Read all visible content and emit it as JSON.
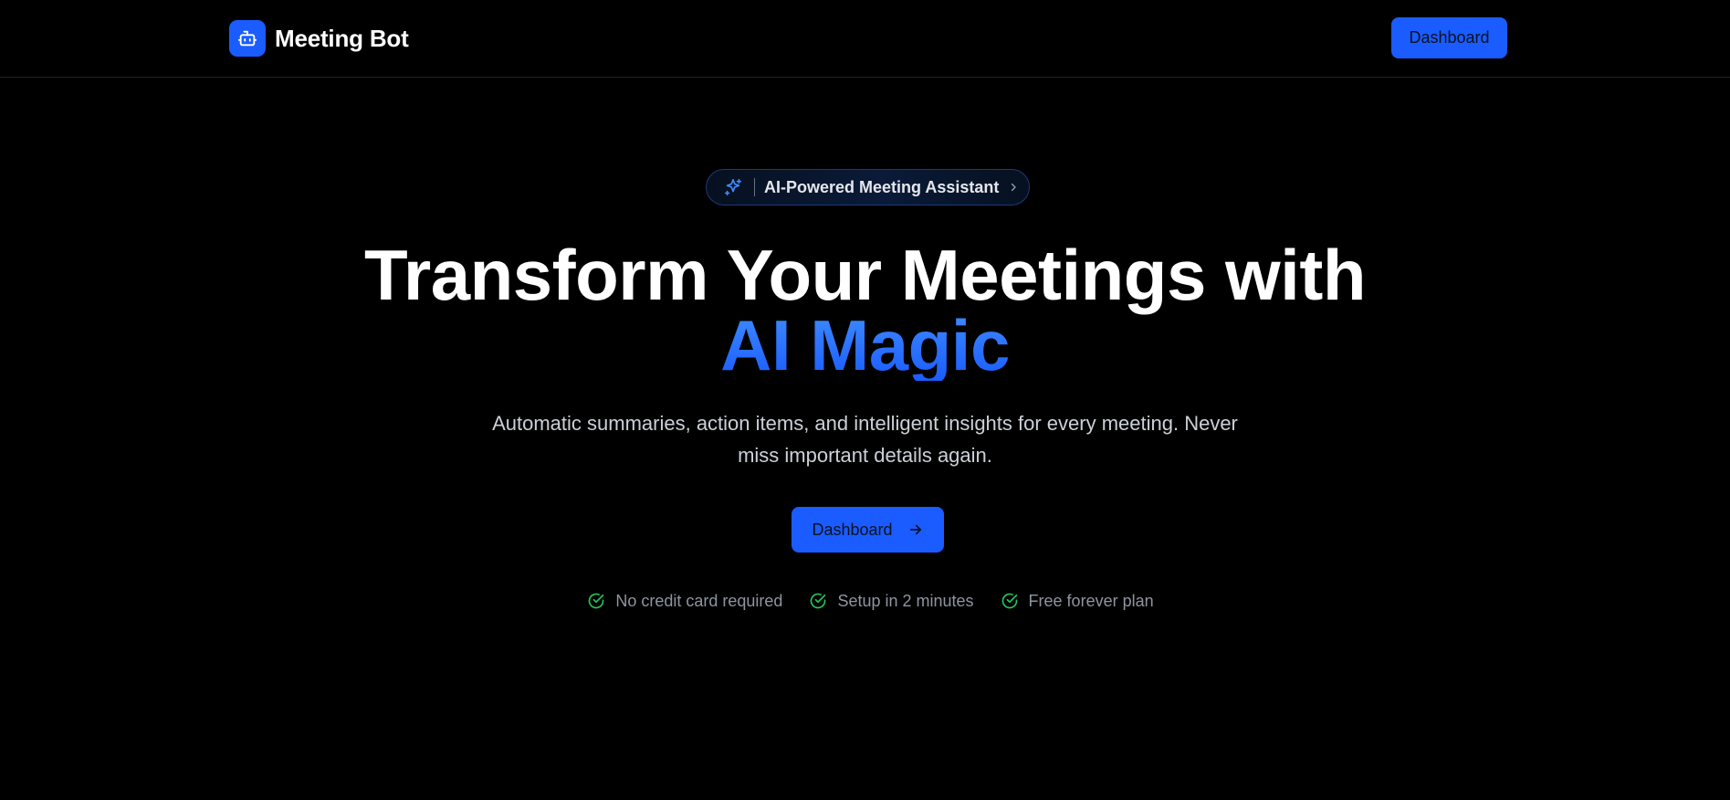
{
  "nav": {
    "brand_name": "Meeting Bot",
    "brand_icon": "bot-icon",
    "dashboard_label": "Dashboard"
  },
  "hero": {
    "badge_icon": "sparkles-icon",
    "badge_text": "AI-Powered Meeting Assistant",
    "headline_line1": "Transform Your Meetings with",
    "headline_line2": "AI Magic",
    "subtext": "Automatic summaries, action items, and intelligent insights for every meeting. Never miss important details again.",
    "cta_label": "Dashboard",
    "cta_icon": "arrow-right-icon"
  },
  "features": [
    {
      "icon": "check-circle-icon",
      "label": "No credit card required"
    },
    {
      "icon": "check-circle-icon",
      "label": "Setup in 2 minutes"
    },
    {
      "icon": "check-circle-icon",
      "label": "Free forever plan"
    }
  ],
  "colors": {
    "background": "#000000",
    "accent": "#1a5cff",
    "accent_light": "#3f8bff",
    "success": "#22c55e",
    "muted_text": "#8e94a0"
  }
}
